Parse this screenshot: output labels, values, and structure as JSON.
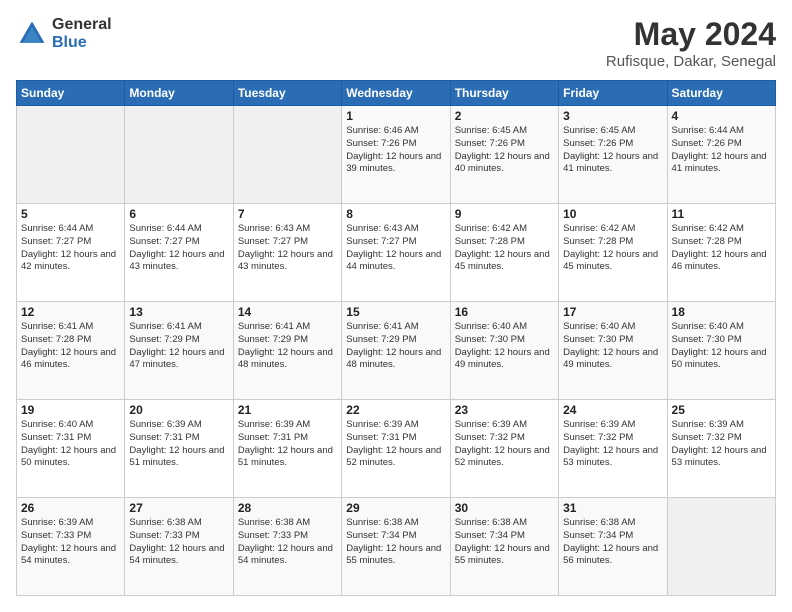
{
  "logo": {
    "general": "General",
    "blue": "Blue"
  },
  "title": {
    "month_year": "May 2024",
    "location": "Rufisque, Dakar, Senegal"
  },
  "headers": [
    "Sunday",
    "Monday",
    "Tuesday",
    "Wednesday",
    "Thursday",
    "Friday",
    "Saturday"
  ],
  "weeks": [
    [
      {
        "day": "",
        "sunrise": "",
        "sunset": "",
        "daylight": ""
      },
      {
        "day": "",
        "sunrise": "",
        "sunset": "",
        "daylight": ""
      },
      {
        "day": "",
        "sunrise": "",
        "sunset": "",
        "daylight": ""
      },
      {
        "day": "1",
        "sunrise": "Sunrise: 6:46 AM",
        "sunset": "Sunset: 7:26 PM",
        "daylight": "Daylight: 12 hours and 39 minutes."
      },
      {
        "day": "2",
        "sunrise": "Sunrise: 6:45 AM",
        "sunset": "Sunset: 7:26 PM",
        "daylight": "Daylight: 12 hours and 40 minutes."
      },
      {
        "day": "3",
        "sunrise": "Sunrise: 6:45 AM",
        "sunset": "Sunset: 7:26 PM",
        "daylight": "Daylight: 12 hours and 41 minutes."
      },
      {
        "day": "4",
        "sunrise": "Sunrise: 6:44 AM",
        "sunset": "Sunset: 7:26 PM",
        "daylight": "Daylight: 12 hours and 41 minutes."
      }
    ],
    [
      {
        "day": "5",
        "sunrise": "Sunrise: 6:44 AM",
        "sunset": "Sunset: 7:27 PM",
        "daylight": "Daylight: 12 hours and 42 minutes."
      },
      {
        "day": "6",
        "sunrise": "Sunrise: 6:44 AM",
        "sunset": "Sunset: 7:27 PM",
        "daylight": "Daylight: 12 hours and 43 minutes."
      },
      {
        "day": "7",
        "sunrise": "Sunrise: 6:43 AM",
        "sunset": "Sunset: 7:27 PM",
        "daylight": "Daylight: 12 hours and 43 minutes."
      },
      {
        "day": "8",
        "sunrise": "Sunrise: 6:43 AM",
        "sunset": "Sunset: 7:27 PM",
        "daylight": "Daylight: 12 hours and 44 minutes."
      },
      {
        "day": "9",
        "sunrise": "Sunrise: 6:42 AM",
        "sunset": "Sunset: 7:28 PM",
        "daylight": "Daylight: 12 hours and 45 minutes."
      },
      {
        "day": "10",
        "sunrise": "Sunrise: 6:42 AM",
        "sunset": "Sunset: 7:28 PM",
        "daylight": "Daylight: 12 hours and 45 minutes."
      },
      {
        "day": "11",
        "sunrise": "Sunrise: 6:42 AM",
        "sunset": "Sunset: 7:28 PM",
        "daylight": "Daylight: 12 hours and 46 minutes."
      }
    ],
    [
      {
        "day": "12",
        "sunrise": "Sunrise: 6:41 AM",
        "sunset": "Sunset: 7:28 PM",
        "daylight": "Daylight: 12 hours and 46 minutes."
      },
      {
        "day": "13",
        "sunrise": "Sunrise: 6:41 AM",
        "sunset": "Sunset: 7:29 PM",
        "daylight": "Daylight: 12 hours and 47 minutes."
      },
      {
        "day": "14",
        "sunrise": "Sunrise: 6:41 AM",
        "sunset": "Sunset: 7:29 PM",
        "daylight": "Daylight: 12 hours and 48 minutes."
      },
      {
        "day": "15",
        "sunrise": "Sunrise: 6:41 AM",
        "sunset": "Sunset: 7:29 PM",
        "daylight": "Daylight: 12 hours and 48 minutes."
      },
      {
        "day": "16",
        "sunrise": "Sunrise: 6:40 AM",
        "sunset": "Sunset: 7:30 PM",
        "daylight": "Daylight: 12 hours and 49 minutes."
      },
      {
        "day": "17",
        "sunrise": "Sunrise: 6:40 AM",
        "sunset": "Sunset: 7:30 PM",
        "daylight": "Daylight: 12 hours and 49 minutes."
      },
      {
        "day": "18",
        "sunrise": "Sunrise: 6:40 AM",
        "sunset": "Sunset: 7:30 PM",
        "daylight": "Daylight: 12 hours and 50 minutes."
      }
    ],
    [
      {
        "day": "19",
        "sunrise": "Sunrise: 6:40 AM",
        "sunset": "Sunset: 7:31 PM",
        "daylight": "Daylight: 12 hours and 50 minutes."
      },
      {
        "day": "20",
        "sunrise": "Sunrise: 6:39 AM",
        "sunset": "Sunset: 7:31 PM",
        "daylight": "Daylight: 12 hours and 51 minutes."
      },
      {
        "day": "21",
        "sunrise": "Sunrise: 6:39 AM",
        "sunset": "Sunset: 7:31 PM",
        "daylight": "Daylight: 12 hours and 51 minutes."
      },
      {
        "day": "22",
        "sunrise": "Sunrise: 6:39 AM",
        "sunset": "Sunset: 7:31 PM",
        "daylight": "Daylight: 12 hours and 52 minutes."
      },
      {
        "day": "23",
        "sunrise": "Sunrise: 6:39 AM",
        "sunset": "Sunset: 7:32 PM",
        "daylight": "Daylight: 12 hours and 52 minutes."
      },
      {
        "day": "24",
        "sunrise": "Sunrise: 6:39 AM",
        "sunset": "Sunset: 7:32 PM",
        "daylight": "Daylight: 12 hours and 53 minutes."
      },
      {
        "day": "25",
        "sunrise": "Sunrise: 6:39 AM",
        "sunset": "Sunset: 7:32 PM",
        "daylight": "Daylight: 12 hours and 53 minutes."
      }
    ],
    [
      {
        "day": "26",
        "sunrise": "Sunrise: 6:39 AM",
        "sunset": "Sunset: 7:33 PM",
        "daylight": "Daylight: 12 hours and 54 minutes."
      },
      {
        "day": "27",
        "sunrise": "Sunrise: 6:38 AM",
        "sunset": "Sunset: 7:33 PM",
        "daylight": "Daylight: 12 hours and 54 minutes."
      },
      {
        "day": "28",
        "sunrise": "Sunrise: 6:38 AM",
        "sunset": "Sunset: 7:33 PM",
        "daylight": "Daylight: 12 hours and 54 minutes."
      },
      {
        "day": "29",
        "sunrise": "Sunrise: 6:38 AM",
        "sunset": "Sunset: 7:34 PM",
        "daylight": "Daylight: 12 hours and 55 minutes."
      },
      {
        "day": "30",
        "sunrise": "Sunrise: 6:38 AM",
        "sunset": "Sunset: 7:34 PM",
        "daylight": "Daylight: 12 hours and 55 minutes."
      },
      {
        "day": "31",
        "sunrise": "Sunrise: 6:38 AM",
        "sunset": "Sunset: 7:34 PM",
        "daylight": "Daylight: 12 hours and 56 minutes."
      },
      {
        "day": "",
        "sunrise": "",
        "sunset": "",
        "daylight": ""
      }
    ]
  ]
}
